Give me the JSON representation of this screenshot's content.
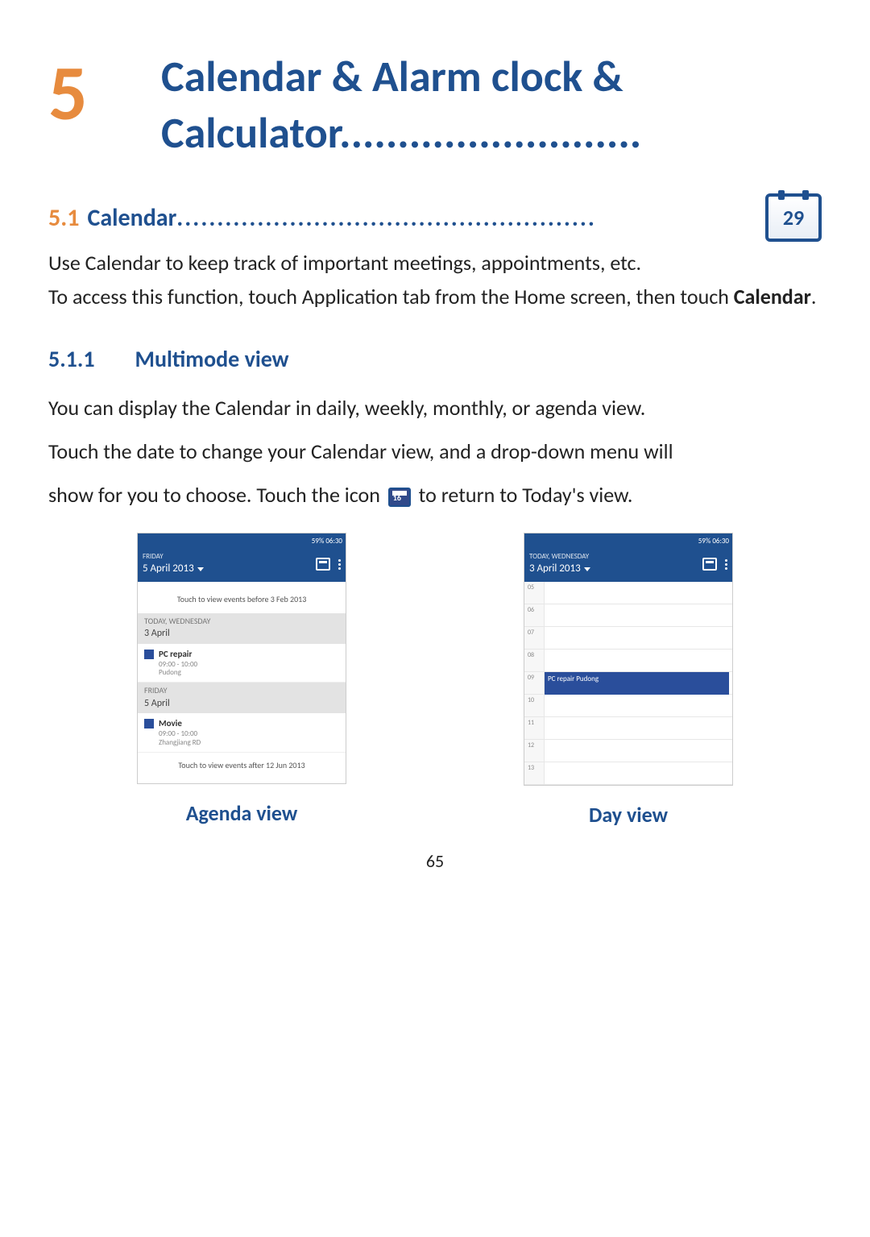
{
  "chapter": {
    "number": "5",
    "title": "Calendar & Alarm clock & Calculator.........................."
  },
  "section51": {
    "number": "5.1",
    "title": "Calendar",
    "dots": "....................................................",
    "icon_day": "29",
    "para1": "Use Calendar to keep track of important meetings, appointments, etc.",
    "para2_a": "To access this function, touch Application tab from the Home screen, then touch ",
    "para2_strong": "Calendar",
    "para2_b": "."
  },
  "section511": {
    "number": "5.1.1",
    "title": "Multimode view",
    "para1": "You can display the Calendar in daily, weekly, monthly, or agenda view.",
    "para2": "Touch the date to change your Calendar view, and a drop-down menu will",
    "para3_a": "show for you to choose. Touch the icon ",
    "para3_b": " to return to Today's view."
  },
  "agenda_shot": {
    "status": "59%  06:30",
    "bar_tiny": "FRIDAY",
    "bar_date": "5 April 2013",
    "hint_before": "Touch to view events before 3 Feb 2013",
    "group1_sub": "TODAY, WEDNESDAY",
    "group1_main": "3 April",
    "ev1_title": "PC repair",
    "ev1_time": "09:00 - 10:00",
    "ev1_loc": "Pudong",
    "group2_sub": "FRIDAY",
    "group2_main": "5 April",
    "ev2_title": "Movie",
    "ev2_time": "09:00 - 10:00",
    "ev2_loc": "Zhangjiang RD",
    "hint_after": "Touch to view events after 12 Jun 2013",
    "caption": "Agenda view"
  },
  "day_shot": {
    "status": "59%  06:30",
    "bar_tiny": "TODAY, WEDNESDAY",
    "bar_date": "3 April 2013",
    "hours": [
      "05",
      "06",
      "07",
      "08",
      "09",
      "10",
      "11",
      "12",
      "13"
    ],
    "event_label": "PC repair Pudong",
    "caption": "Day view"
  },
  "page_number": "65"
}
